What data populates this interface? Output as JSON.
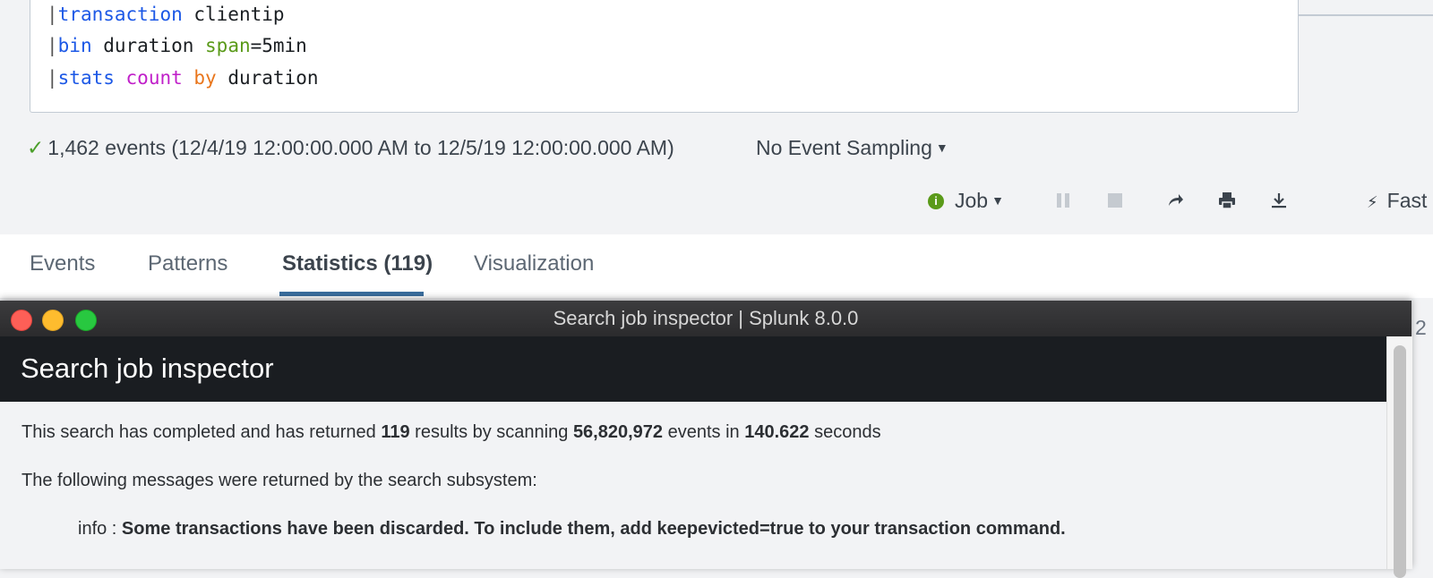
{
  "search": {
    "lines": [
      {
        "pipe": "|",
        "cmd": "transaction",
        "rest": " clientip"
      },
      {
        "pipe": "|",
        "cmd": "bin",
        "arg1": " duration ",
        "opt": "span",
        "val": "=5min"
      },
      {
        "pipe": "|",
        "cmd": "stats",
        "sp1": " ",
        "fn": "count",
        "sp2": " ",
        "by": "by",
        "rest": " duration"
      }
    ]
  },
  "status": {
    "check_icon": "check-icon",
    "events_summary": "1,462 events (12/4/19 12:00:00.000 AM to 12/5/19 12:00:00.000 AM)",
    "sampling_label": "No Event Sampling"
  },
  "toolbar": {
    "job_label": "Job",
    "fast_label": "Fast"
  },
  "tabs": [
    {
      "label": "Events"
    },
    {
      "label": "Patterns"
    },
    {
      "label": "Statistics (119)"
    },
    {
      "label": "Visualization"
    }
  ],
  "behind": {
    "fragment": "2"
  },
  "inspector": {
    "window_title": "Search job inspector | Splunk 8.0.0",
    "header_title": "Search job inspector",
    "summary": {
      "p1": "This search has completed and has returned ",
      "results": "119",
      "p2": " results by scanning ",
      "events": "56,820,972",
      "p3": " events in ",
      "seconds": "140.622",
      "p4": " seconds"
    },
    "messages_intro": "The following messages were returned by the search subsystem:",
    "message": {
      "level": "info : ",
      "text": "Some transactions have been discarded. To include them, add keepevicted=true to your transaction command."
    }
  },
  "colors": {
    "accent": "#3a6d9d",
    "keyword_blue": "#1c58e6",
    "keyword_green": "#5a9a19",
    "keyword_purple": "#c01fc9",
    "keyword_orange": "#e9761c",
    "status_green": "#4b9f2b"
  }
}
